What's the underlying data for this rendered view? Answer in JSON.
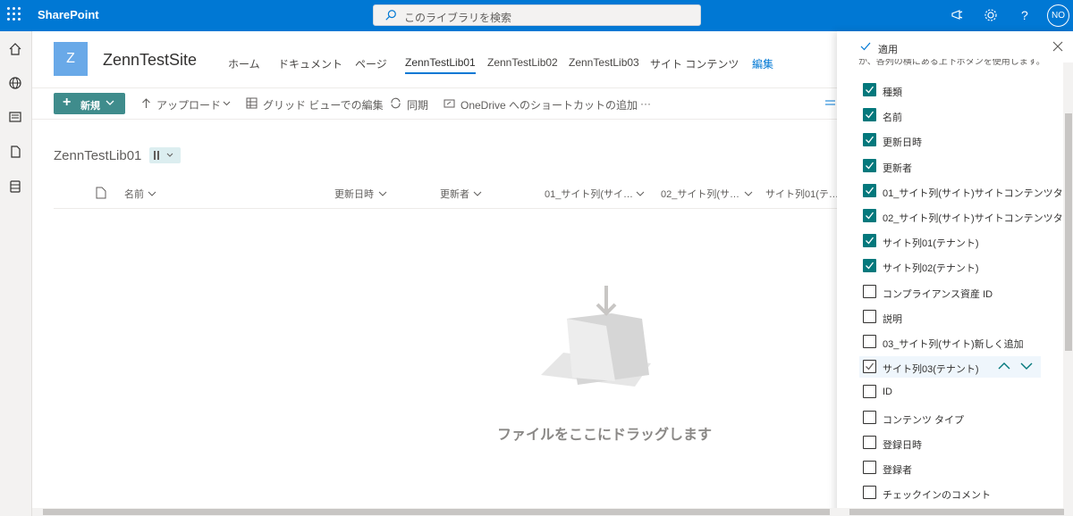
{
  "suite": {
    "brand": "SharePoint",
    "search_placeholder": "このライブラリを検索",
    "avatar_initials": "NO"
  },
  "site": {
    "logo_letter": "Z",
    "title": "ZennTestSite"
  },
  "nav": [
    "ホーム",
    "ドキュメント",
    "ページ",
    "ZennTestLib01",
    "ZennTestLib02",
    "ZennTestLib03",
    "サイト コンテンツ",
    "編集"
  ],
  "commands": {
    "new": "新規",
    "upload": "アップロード",
    "grid_edit": "グリッド ビューでの編集",
    "sync": "同期",
    "onedrive": "OneDrive へのショートカットの追加",
    "more": "···"
  },
  "library": {
    "title": "ZennTestLib01",
    "columns": [
      "名前",
      "更新日時",
      "更新者",
      "01_サイト列(サイ…",
      "02_サイト列(サ…",
      "サイト列01(テ…"
    ],
    "empty_message": "ファイルをここにドラッグします"
  },
  "panel": {
    "apply": "適用",
    "hint": "か、各列の横にある上下ボタンを使用します。",
    "items": [
      {
        "label": "種類",
        "checked": true
      },
      {
        "label": "名前",
        "checked": true
      },
      {
        "label": "更新日時",
        "checked": true
      },
      {
        "label": "更新者",
        "checked": true
      },
      {
        "label": "01_サイト列(サイト)サイトコンテンツタ-",
        "checked": true
      },
      {
        "label": "02_サイト列(サイト)サイトコンテンツタ-",
        "checked": true
      },
      {
        "label": "サイト列01(テナント)",
        "checked": true
      },
      {
        "label": "サイト列02(テナント)",
        "checked": true
      },
      {
        "label": "コンプライアンス資産 ID",
        "checked": false
      },
      {
        "label": "説明",
        "checked": false
      },
      {
        "label": "03_サイト列(サイト)新しく追加",
        "checked": false
      },
      {
        "label": "サイト列03(テナント)",
        "checked": false
      },
      {
        "label": "ID",
        "checked": false
      },
      {
        "label": "コンテンツ タイプ",
        "checked": false
      },
      {
        "label": "登録日時",
        "checked": false
      },
      {
        "label": "登録者",
        "checked": false
      },
      {
        "label": "チェックインのコメント",
        "checked": false
      }
    ]
  },
  "colors": {
    "suite": "#0078d4",
    "accent": "#03787c",
    "new_button": "#3f8c8c"
  }
}
